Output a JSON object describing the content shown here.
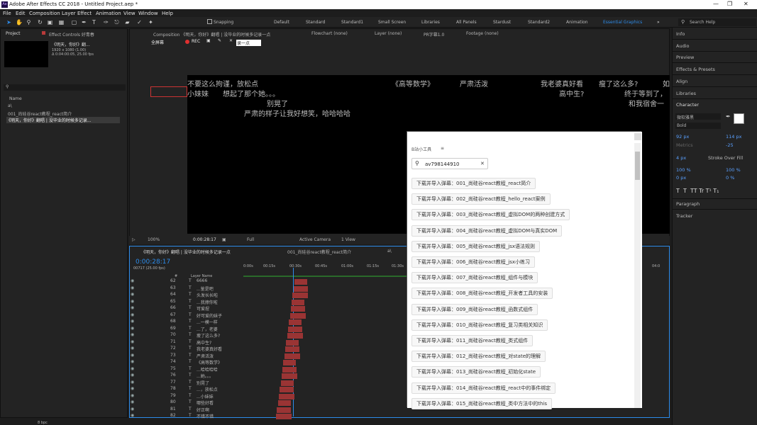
{
  "app": {
    "title": "Adobe After Effects CC 2018 - Untitled Project.aep *",
    "logo": "Ae"
  },
  "menu": [
    "File",
    "Edit",
    "Composition",
    "Layer",
    "Effect",
    "Animation",
    "View",
    "Window",
    "Help"
  ],
  "toolbar": {
    "snapping": "Snapping"
  },
  "workspaces": [
    "Default",
    "Standard",
    "Small Screen",
    "Libraries",
    "All Panels",
    "Stardust",
    "Standard2",
    "Animation",
    "Essential Graphics"
  ],
  "search_help": "Search Help",
  "project": {
    "tab": "Project",
    "effects_tab": "Effect Controls 好青春",
    "comp_name": "《明天，你好》翻...",
    "comp_info1": "1920 x 1080 (1.00)",
    "comp_info2": "Δ 0:04:00:05, 25.00 fps",
    "col_name": "Name",
    "items": [
      "a\\",
      "001_尚硅谷react教程_react简介",
      "《明天，你好》翻唱 | 没毕业的时候多记录..."
    ],
    "bpc": "8 bpc"
  },
  "comp_panel": {
    "tab": "Composition 《明天，你好》翻唱 | 没毕业的时候多记录一点",
    "flowchart": "Flowchart (none)",
    "layer": "Layer (none)",
    "pr_font": "PR字幕1.0",
    "footage": "Footage (none)",
    "fullscreen": "全屏幕",
    "rec": "REC",
    "edit_box": "录一点",
    "zoom": "100%",
    "timecode": "0:00:28:17",
    "quality": "Full",
    "camera": "Active Camera",
    "view": "1 View"
  },
  "subtitles": [
    "不要这么拘谨，放松点",
    "小妹妹",
    "想起了那个她。。。",
    "别晃了",
    "严肃的样子让我好想笑，哈哈哈哈",
    "《高等数学》",
    "严肃活泼",
    "我老婆真好看",
    "瘦了这么多?",
    "高中生?",
    "终于等到了，",
    "和我宿舍一",
    "如"
  ],
  "timeline": {
    "tab1": "《明天，你好》翻唱 | 没毕业的时候多记录一点",
    "tab2": "001_尚硅谷react教程_react简介",
    "tab3": "a\\",
    "timecode": "0:00:28:17",
    "frame": "00717 (25.00 fps)",
    "col_hash": "#",
    "col_layer": "Layer Name",
    "ruler": [
      "0:00s",
      "00:15s",
      "00:30s",
      "00:45s",
      "01:00s",
      "01:15s",
      "01:30s",
      "04:0"
    ],
    "layers": [
      {
        "num": "62",
        "name": "6666"
      },
      {
        "num": "63",
        "name": "...鉴是吧"
      },
      {
        "num": "64",
        "name": "头发长长啦"
      },
      {
        "num": "65",
        "name": "...我擦你啦"
      },
      {
        "num": "66",
        "name": "可爱捏"
      },
      {
        "num": "67",
        "name": "好可爱的妹子"
      },
      {
        "num": "68",
        "name": "...一模一样"
      },
      {
        "num": "69",
        "name": "...了，老婆"
      },
      {
        "num": "70",
        "name": "瘦了这么多?"
      },
      {
        "num": "71",
        "name": "高中生?"
      },
      {
        "num": "72",
        "name": "我老婆真好看"
      },
      {
        "num": "73",
        "name": "严肃活泼"
      },
      {
        "num": "74",
        "name": "《高等数学》"
      },
      {
        "num": "75",
        "name": "...哈哈哈哈"
      },
      {
        "num": "76",
        "name": "...她。。。"
      },
      {
        "num": "77",
        "name": "别晃了"
      },
      {
        "num": "78",
        "name": "...，放松点"
      },
      {
        "num": "79",
        "name": "...小妹妹"
      },
      {
        "num": "80",
        "name": "哪些好看"
      },
      {
        "num": "81",
        "name": "好正啊"
      },
      {
        "num": "82",
        "name": "不错不错"
      }
    ]
  },
  "bili": {
    "title": "B站小工具",
    "search_value": "av798144910",
    "items": [
      "下载并导入弹幕：001_尚硅谷react教程_react简介",
      "下载并导入弹幕：002_尚硅谷react教程_hello_react案例",
      "下载并导入弹幕：003_尚硅谷react教程_虚拟DOM的两种创建方式",
      "下载并导入弹幕：004_尚硅谷react教程_虚拟DOM与真实DOM",
      "下载并导入弹幕：005_尚硅谷react教程_jsx语法规则",
      "下载并导入弹幕：006_尚硅谷react教程_jsx小练习",
      "下载并导入弹幕：007_尚硅谷react教程_组件与模块",
      "下载并导入弹幕：008_尚硅谷react教程_开发者工具的安装",
      "下载并导入弹幕：009_尚硅谷react教程_函数式组件",
      "下载并导入弹幕：010_尚硅谷react教程_复习类相关知识",
      "下载并导入弹幕：011_尚硅谷react教程_类式组件",
      "下载并导入弹幕：012_尚硅谷react教程_对state的理解",
      "下载并导入弹幕：013_尚硅谷react教程_初始化state",
      "下载并导入弹幕：014_尚硅谷react教程_react中的事件绑定",
      "下载并导入弹幕：015_尚硅谷react教程_类中方法中的this"
    ]
  },
  "right_panel": {
    "items": [
      "Info",
      "Audio",
      "Preview",
      "Effects & Presets",
      "Align",
      "Libraries"
    ],
    "character": "Character",
    "font": "微软雅黑",
    "style": "Bold",
    "size": "92 px",
    "leading": "114 px",
    "tracking": "-25",
    "metrics": "Metrics",
    "stroke": "4 px",
    "stroke_type": "Stroke Over Fill",
    "vscale": "100 %",
    "hscale": "100 %",
    "baseline": "0 px",
    "tsume": "0 %",
    "paragraph": "Paragraph",
    "tracker": "Tracker"
  }
}
